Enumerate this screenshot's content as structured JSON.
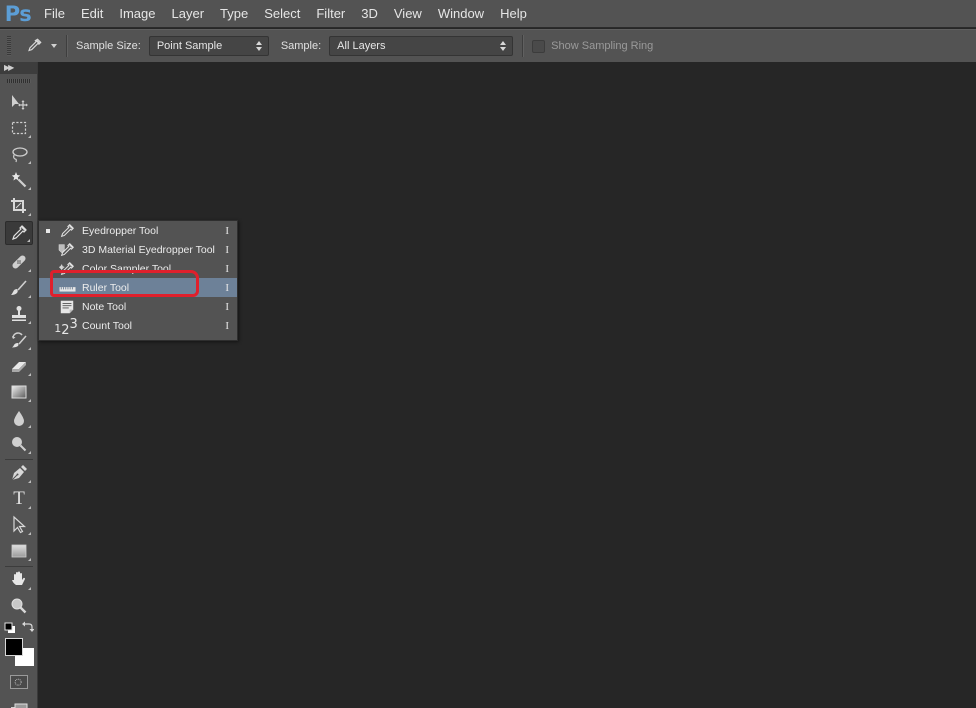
{
  "app": {
    "logo": "Ps",
    "accent": "#5c9ed6"
  },
  "menubar": {
    "items": [
      "File",
      "Edit",
      "Image",
      "Layer",
      "Type",
      "Select",
      "Filter",
      "3D",
      "View",
      "Window",
      "Help"
    ]
  },
  "options": {
    "current_tool_icon": "eyedropper-icon",
    "sample_size_label": "Sample Size:",
    "sample_size_value": "Point Sample",
    "sample_label": "Sample:",
    "sample_value": "All Layers",
    "show_sampling_ring_label": "Show Sampling Ring",
    "show_sampling_ring_checked": false,
    "show_sampling_ring_enabled": false
  },
  "toolbar": {
    "tools": [
      {
        "name": "move-tool",
        "icon": "move-icon"
      },
      {
        "name": "rectangular-marquee-tool",
        "icon": "marquee-icon"
      },
      {
        "name": "lasso-tool",
        "icon": "lasso-icon"
      },
      {
        "name": "magic-wand-tool",
        "icon": "magic-wand-icon"
      },
      {
        "name": "crop-tool",
        "icon": "crop-icon"
      },
      {
        "name": "eyedropper-tool",
        "icon": "eyedropper-icon",
        "active": true
      },
      {
        "name": "healing-brush-tool",
        "icon": "bandage-icon"
      },
      {
        "name": "brush-tool",
        "icon": "brush-icon"
      },
      {
        "name": "clone-stamp-tool",
        "icon": "stamp-icon"
      },
      {
        "name": "history-brush-tool",
        "icon": "history-brush-icon"
      },
      {
        "name": "eraser-tool",
        "icon": "eraser-icon"
      },
      {
        "name": "gradient-tool",
        "icon": "gradient-icon"
      },
      {
        "name": "blur-tool",
        "icon": "drop-icon"
      },
      {
        "name": "dodge-tool",
        "icon": "dodge-icon"
      },
      {
        "name": "pen-tool",
        "icon": "pen-icon"
      },
      {
        "name": "type-tool",
        "icon": "type-icon"
      },
      {
        "name": "path-selection-tool",
        "icon": "arrow-icon"
      },
      {
        "name": "rectangle-tool",
        "icon": "rectangle-icon"
      },
      {
        "name": "hand-tool",
        "icon": "hand-icon"
      },
      {
        "name": "zoom-tool",
        "icon": "zoom-icon"
      }
    ],
    "type_glyph": "T",
    "foreground_color": "#000000",
    "background_color": "#ffffff"
  },
  "flyout": {
    "items": [
      {
        "label": "Eyedropper Tool",
        "shortcut": "I",
        "icon": "eyedropper-icon",
        "current": true,
        "highlighted": false
      },
      {
        "label": "3D Material Eyedropper Tool",
        "shortcut": "I",
        "icon": "3d-material-eyedropper-icon",
        "current": false,
        "highlighted": false
      },
      {
        "label": "Color Sampler Tool",
        "shortcut": "I",
        "icon": "color-sampler-icon",
        "current": false,
        "highlighted": false
      },
      {
        "label": "Ruler Tool",
        "shortcut": "I",
        "icon": "ruler-icon",
        "current": false,
        "highlighted": true
      },
      {
        "label": "Note Tool",
        "shortcut": "I",
        "icon": "note-icon",
        "current": false,
        "highlighted": false
      },
      {
        "label": "Count Tool",
        "shortcut": "I",
        "icon": "count-icon",
        "current": false,
        "highlighted": false
      }
    ],
    "count_glyph": "123",
    "annotation_color": "#e0202c"
  }
}
